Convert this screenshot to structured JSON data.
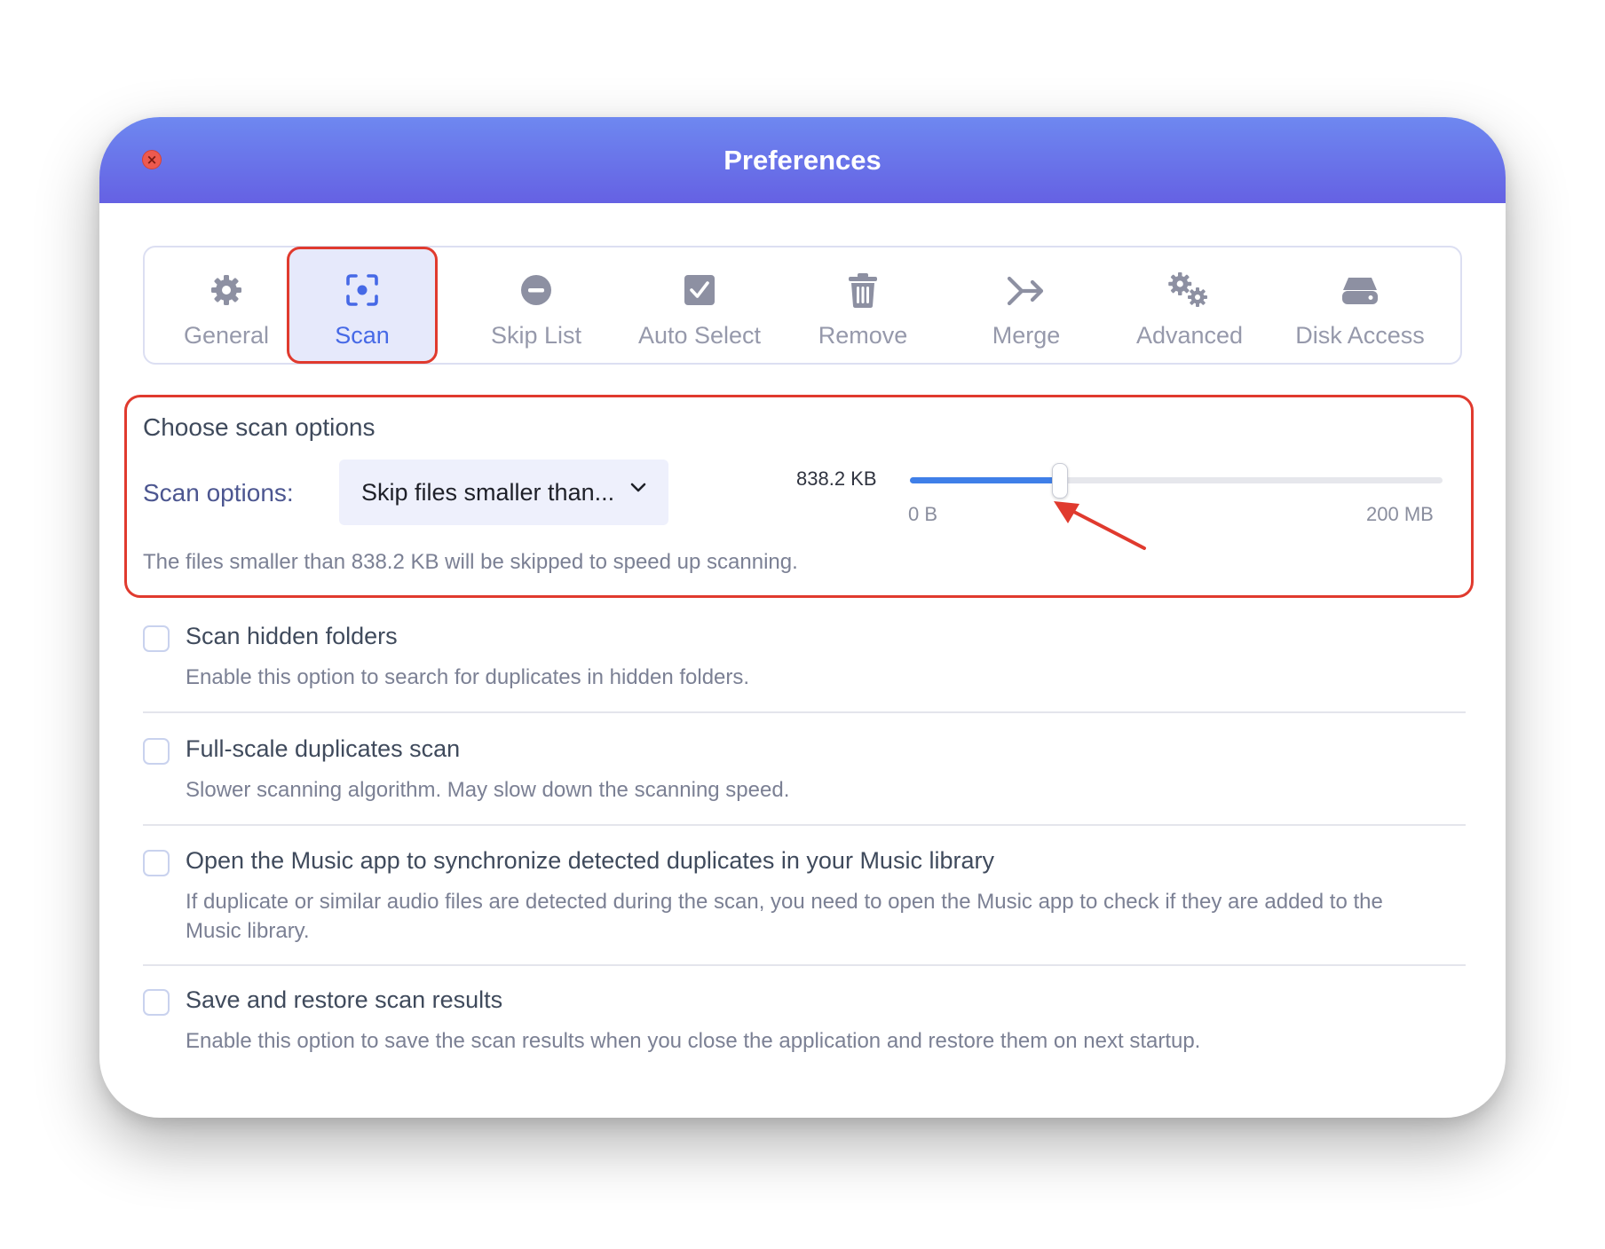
{
  "window": {
    "title": "Preferences"
  },
  "tabs": [
    {
      "label": "General",
      "icon": "gear-icon"
    },
    {
      "label": "Scan",
      "icon": "scan-icon",
      "active": true
    },
    {
      "label": "Skip List",
      "icon": "minus-circle-icon"
    },
    {
      "label": "Auto Select",
      "icon": "checkbox-icon"
    },
    {
      "label": "Remove",
      "icon": "trash-icon"
    },
    {
      "label": "Merge",
      "icon": "merge-arrow-icon"
    },
    {
      "label": "Advanced",
      "icon": "gears-icon"
    },
    {
      "label": "Disk Access",
      "icon": "disk-icon"
    }
  ],
  "scan_options": {
    "section_title": "Choose scan options",
    "label": "Scan options:",
    "dropdown_value": "Skip files smaller than...",
    "size_value": "838.2 KB",
    "slider_min": "0 B",
    "slider_max": "200 MB",
    "slider_fraction": 0.28,
    "description": "The files smaller than 838.2 KB will be skipped to speed up scanning."
  },
  "options": [
    {
      "title": "Scan hidden folders",
      "description": "Enable this option to search for duplicates in hidden folders.",
      "checked": false
    },
    {
      "title": "Full-scale duplicates scan",
      "description": "Slower scanning algorithm. May slow down the scanning speed.",
      "checked": false
    },
    {
      "title": "Open the Music app to synchronize detected duplicates in your Music library",
      "description": "If duplicate or similar audio files are detected during the scan, you need to open the Music app to check if they are added to the Music library.",
      "checked": false
    },
    {
      "title": "Save and restore scan results",
      "description": "Enable this option to save the scan results when you close the application and restore them on next startup.",
      "checked": false
    }
  ],
  "colors": {
    "titlebar_start": "#6e88f0",
    "titlebar_end": "#6561e3",
    "accent": "#4669e6",
    "slider_fill": "#3f7fe8",
    "highlight": "#e03a2e"
  }
}
